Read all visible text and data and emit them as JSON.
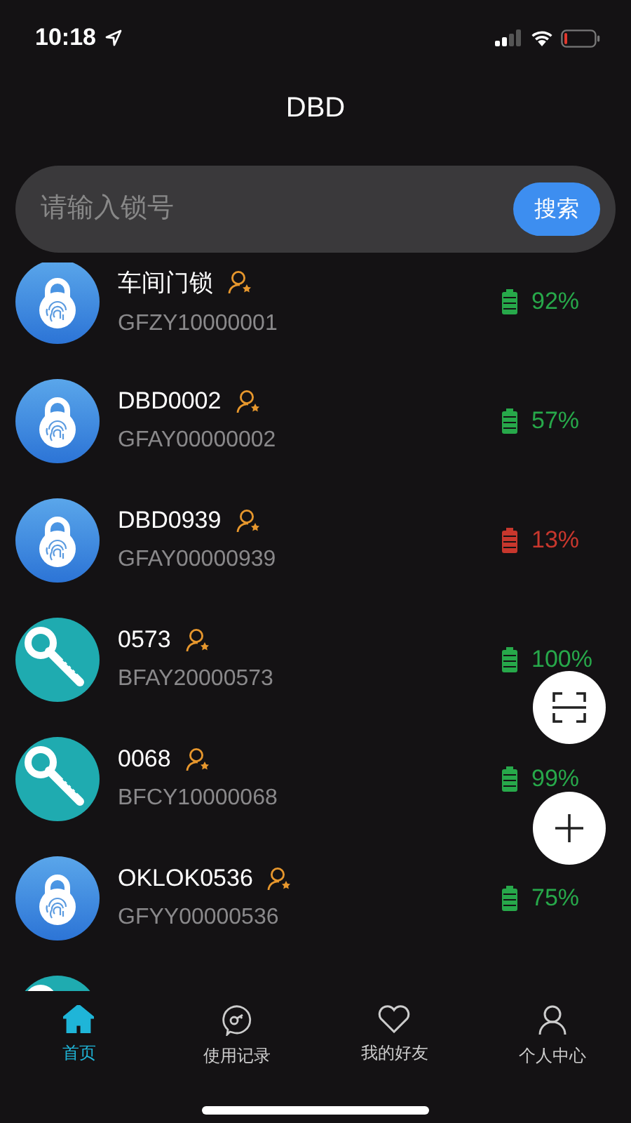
{
  "status_bar": {
    "time": "10:18"
  },
  "title": "DBD",
  "search": {
    "placeholder": "请输入锁号",
    "button": "搜索"
  },
  "locks": [
    {
      "kind": "padlock",
      "name": "车间门锁",
      "code": "GFZY10000001",
      "battery": "92%",
      "color": "#27a84a"
    },
    {
      "kind": "padlock",
      "name": "DBD0002",
      "code": "GFAY00000002",
      "battery": "57%",
      "color": "#27a84a"
    },
    {
      "kind": "padlock",
      "name": "DBD0939",
      "code": "GFAY00000939",
      "battery": "13%",
      "color": "#c8372d"
    },
    {
      "kind": "key",
      "name": "0573",
      "code": "BFAY20000573",
      "battery": "100%",
      "color": "#27a84a"
    },
    {
      "kind": "key",
      "name": "0068",
      "code": "BFCY10000068",
      "battery": "99%",
      "color": "#27a84a"
    },
    {
      "kind": "padlock",
      "name": "OKLOK0536",
      "code": "GFYY00000536",
      "battery": "75%",
      "color": "#27a84a"
    },
    {
      "kind": "key"
    }
  ],
  "tabs": [
    {
      "kind": "home",
      "label": "首页",
      "selected": true
    },
    {
      "kind": "records",
      "label": "使用记录",
      "selected": false
    },
    {
      "kind": "friends",
      "label": "我的好友",
      "selected": false
    },
    {
      "kind": "profile",
      "label": "个人中心",
      "selected": false
    }
  ]
}
